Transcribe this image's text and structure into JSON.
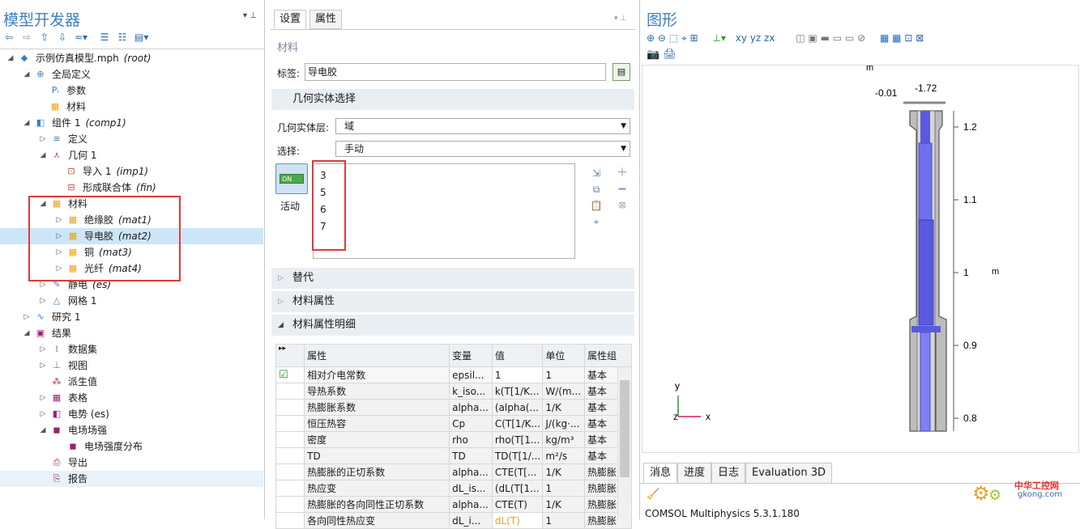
{
  "left": {
    "title": "模型开发器",
    "tree": [
      {
        "label": "示例仿真模型.mph",
        "tag": "(root)"
      },
      {
        "label": "全局定义",
        "tag": ""
      },
      {
        "label": "参数",
        "tag": ""
      },
      {
        "label": "材料",
        "tag": ""
      },
      {
        "label": "组件 1",
        "tag": "(comp1)"
      },
      {
        "label": "定义",
        "tag": ""
      },
      {
        "label": "几何 1",
        "tag": ""
      },
      {
        "label": "导入 1",
        "tag": "(imp1)"
      },
      {
        "label": "形成联合体",
        "tag": "(fin)"
      },
      {
        "label": "材料",
        "tag": ""
      },
      {
        "label": "绝缘胶",
        "tag": "(mat1)"
      },
      {
        "label": "导电胶",
        "tag": "(mat2)"
      },
      {
        "label": "铜",
        "tag": "(mat3)"
      },
      {
        "label": "光纤",
        "tag": "(mat4)"
      },
      {
        "label": "静电",
        "tag": "(es)"
      },
      {
        "label": "网格 1",
        "tag": ""
      },
      {
        "label": "研究 1",
        "tag": ""
      },
      {
        "label": "结果",
        "tag": ""
      },
      {
        "label": "数据集",
        "tag": ""
      },
      {
        "label": "视图",
        "tag": ""
      },
      {
        "label": "派生值",
        "tag": ""
      },
      {
        "label": "表格",
        "tag": ""
      },
      {
        "label": "电势 (es)",
        "tag": ""
      },
      {
        "label": "电场场强",
        "tag": ""
      },
      {
        "label": "电场强度分布",
        "tag": ""
      },
      {
        "label": "导出",
        "tag": ""
      },
      {
        "label": "报告",
        "tag": ""
      }
    ]
  },
  "mid": {
    "tabs": [
      "设置",
      "属性"
    ],
    "heading": "材料",
    "label_caption": "标签:",
    "label_value": "导电胶",
    "geo_section": "几何实体选择",
    "geo_level_caption": "几何实体层:",
    "geo_level_value": "域",
    "selection_caption": "选择:",
    "selection_value": "手动",
    "active_toggle": "ON",
    "active_label": "活动",
    "domains": [
      "3",
      "5",
      "6",
      "7"
    ],
    "sections": [
      "替代",
      "材料属性",
      "材料属性明细"
    ],
    "table": {
      "headers": [
        "属性",
        "变量",
        "值",
        "单位",
        "属性组"
      ],
      "rows": [
        [
          "相对介电常数",
          "epsil...",
          "1",
          "1",
          "基本"
        ],
        [
          "导热系数",
          "k_iso...",
          "k(T[1/K...",
          "W/(m...",
          "基本"
        ],
        [
          "热膨胀系数",
          "alpha...",
          "(alpha(...",
          "1/K",
          "基本"
        ],
        [
          "恒压热容",
          "Cp",
          "C(T[1/K...",
          "J/(kg·...",
          "基本"
        ],
        [
          "密度",
          "rho",
          "rho(T[1...",
          "kg/m³",
          "基本"
        ],
        [
          "TD",
          "TD",
          "TD(T[1/...",
          "m²/s",
          "基本"
        ],
        [
          "热膨胀的正切系数",
          "alpha...",
          "CTE(T[...",
          "1/K",
          "热膨胀"
        ],
        [
          "热应变",
          "dL_is...",
          "(dL(T[1...",
          "1",
          "热膨胀"
        ],
        [
          "热膨胀的各向同性正切系数",
          "alpha...",
          "CTE(T)",
          "1/K",
          "热膨胀"
        ],
        [
          "各向同性热应变",
          "dL_i...",
          "dL(T)",
          "1",
          "热膨胀"
        ]
      ]
    }
  },
  "right": {
    "title": "图形",
    "axis_unit": "m",
    "top_labels": [
      "-0.01",
      "-1.72"
    ],
    "y_ticks": [
      "1.2",
      "1.1",
      "1",
      "0.9",
      "0.8"
    ],
    "triad": {
      "y": "y",
      "x": "x",
      "z": "z"
    },
    "bottom_tabs": [
      "消息",
      "进度",
      "日志",
      "Evaluation 3D"
    ],
    "message": "COMSOL Multiphysics 5.3.1.180",
    "watermark_line1": "中华工控网",
    "watermark_line2": "gkong.com"
  },
  "colors": {
    "accent": "#3c7fc4",
    "material": "#e8a11a",
    "highlight_box": "#e03a3a",
    "blue_fill": "#5a5ae0"
  }
}
